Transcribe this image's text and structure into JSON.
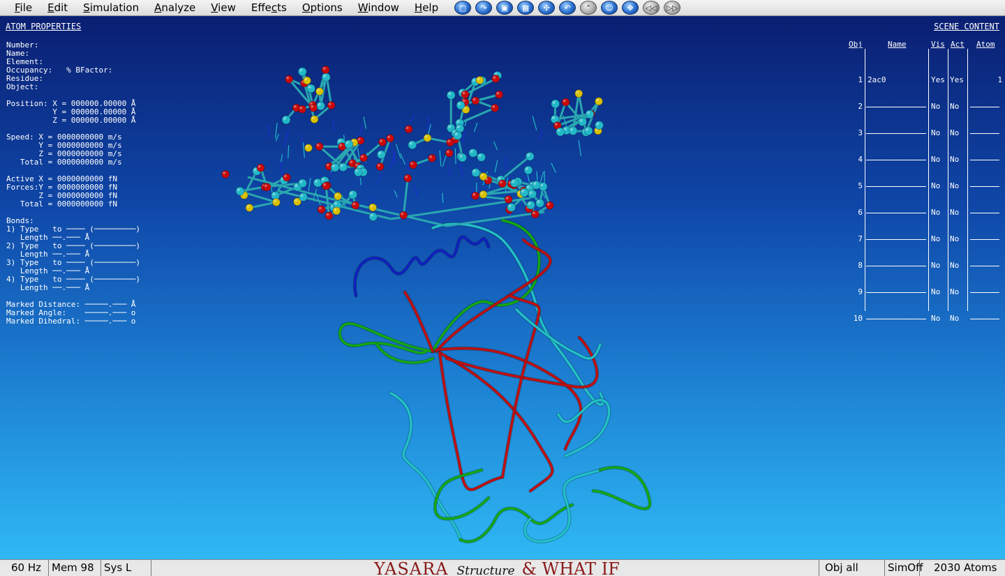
{
  "menu": [
    {
      "pre": "",
      "u": "F",
      "post": "ile"
    },
    {
      "pre": "",
      "u": "E",
      "post": "dit"
    },
    {
      "pre": "",
      "u": "S",
      "post": "imulation"
    },
    {
      "pre": "",
      "u": "A",
      "post": "nalyze"
    },
    {
      "pre": "",
      "u": "V",
      "post": "iew"
    },
    {
      "pre": "Effe",
      "u": "c",
      "post": "ts"
    },
    {
      "pre": "",
      "u": "O",
      "post": "ptions"
    },
    {
      "pre": "",
      "u": "W",
      "post": "indow"
    },
    {
      "pre": "",
      "u": "H",
      "post": "elp"
    }
  ],
  "toolbar": [
    {
      "name": "new-scene-icon",
      "glyph": "▢"
    },
    {
      "name": "load-icon",
      "glyph": "↷"
    },
    {
      "name": "save-icon",
      "glyph": "▣"
    },
    {
      "name": "screenshot-icon",
      "glyph": "▦"
    },
    {
      "name": "rotate-icon",
      "glyph": "✣"
    },
    {
      "name": "undo-icon",
      "glyph": "↶"
    },
    {
      "name": "back-icon",
      "glyph": "⌃"
    },
    {
      "name": "face-icon",
      "glyph": "☺"
    },
    {
      "name": "move-icon",
      "glyph": "✥"
    },
    {
      "name": "rewind-icon",
      "glyph": "◁◁"
    },
    {
      "name": "forward-icon",
      "glyph": "▷▷"
    }
  ],
  "atom_properties": {
    "title": "ATOM PROPERTIES",
    "text": "Number:\nName:\nElement:\nOccupancy:   % BFactor:\nResidue:\nObject:\n\nPosition: X = 000000.00000 Å\n          Y = 000000.00000 Å\n          Z = 000000.00000 Å\n\nSpeed: X = 0000000000 m/s\n       Y = 0000000000 m/s\n       Z = 0000000000 m/s\n   Total = 0000000000 m/s\n\nActive X = 0000000000 fN\nForces:Y = 0000000000 fN\n       Z = 0000000000 fN\n   Total = 0000000000 fN\n\nBonds:\n1) Type   to ──── (─────────)\n   Length ──.─── Å\n2) Type   to ──── (─────────)\n   Length ──.─── Å\n3) Type   to ──── (─────────)\n   Length ──.─── Å\n4) Type   to ──── (─────────)\n   Length ──.─── Å\n\nMarked Distance: ─────.─── Å\nMarked Angle:    ─────.─── o\nMarked Dihedral: ─────.─── o"
  },
  "scene_content": {
    "title": "SCENE CONTENT",
    "headers": {
      "obj": "Obj",
      "name": "Name",
      "vis": "Vis",
      "act": "Act",
      "atom": "Atom"
    },
    "rows": [
      {
        "obj": "1",
        "name": "2ac0",
        "vis": "Yes",
        "act": "Yes",
        "atom": "1"
      },
      {
        "obj": "2",
        "name": "",
        "vis": "No",
        "act": "No",
        "atom": ""
      },
      {
        "obj": "3",
        "name": "",
        "vis": "No",
        "act": "No",
        "atom": ""
      },
      {
        "obj": "4",
        "name": "",
        "vis": "No",
        "act": "No",
        "atom": ""
      },
      {
        "obj": "5",
        "name": "",
        "vis": "No",
        "act": "No",
        "atom": ""
      },
      {
        "obj": "6",
        "name": "",
        "vis": "No",
        "act": "No",
        "atom": ""
      },
      {
        "obj": "7",
        "name": "",
        "vis": "No",
        "act": "No",
        "atom": ""
      },
      {
        "obj": "8",
        "name": "",
        "vis": "No",
        "act": "No",
        "atom": ""
      },
      {
        "obj": "9",
        "name": "",
        "vis": "No",
        "act": "No",
        "atom": ""
      },
      {
        "obj": "10",
        "name": "",
        "vis": "No",
        "act": "No",
        "atom": ""
      }
    ]
  },
  "statusbar": {
    "hz": "60  Hz",
    "mem": "Mem 98",
    "sys": "Sys L",
    "brand_yasara": "YASARA",
    "brand_structure": "Structure",
    "brand_whatif": "& WHAT IF",
    "obj": "Obj  all",
    "sim": "SimOff",
    "atoms": "2030 Atoms"
  },
  "colors": {
    "carbon": "#22b8c8",
    "oxygen": "#c80a0a",
    "phosphorus": "#d8c000",
    "strand": "#c01010",
    "coil": "#22c0c8",
    "turn": "#14a814",
    "helix": "#1020c0"
  }
}
